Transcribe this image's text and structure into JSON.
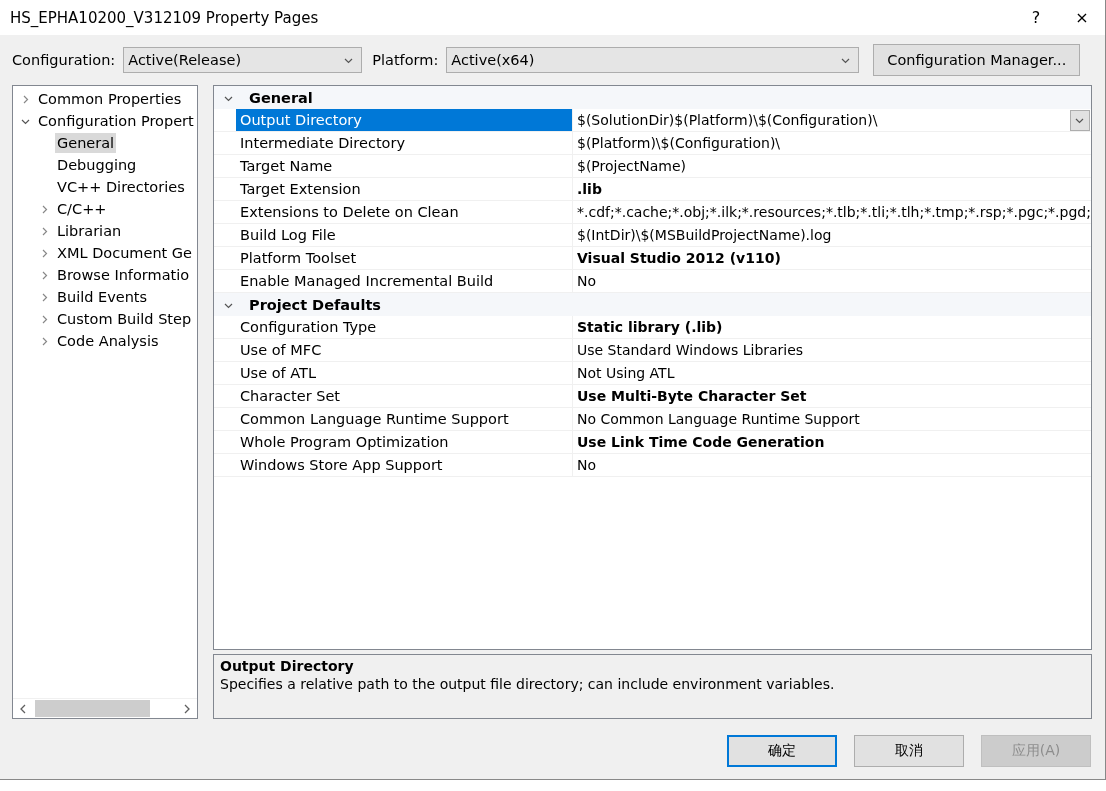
{
  "window": {
    "title": "HS_EPHA10200_V312109 Property Pages",
    "help": "?",
    "close": "×"
  },
  "toolbar": {
    "configuration_label": "Configuration:",
    "configuration": "Active(Release)",
    "platform_label": "Platform:",
    "platform": "Active(x64)",
    "manager_button": "Configuration Manager..."
  },
  "tree": [
    {
      "label": "Common Properties",
      "expanded": false,
      "selected": false
    },
    {
      "label": "Configuration Propert",
      "expanded": true,
      "selected": false,
      "children": [
        {
          "label": "General",
          "selected": true
        },
        {
          "label": "Debugging",
          "selected": false
        },
        {
          "label": "VC++ Directories",
          "selected": false
        },
        {
          "label": "C/C++",
          "expanded": false,
          "selected": false
        },
        {
          "label": "Librarian",
          "expanded": false,
          "selected": false
        },
        {
          "label": "XML Document Ge",
          "expanded": false,
          "selected": false
        },
        {
          "label": "Browse Informatio",
          "expanded": false,
          "selected": false
        },
        {
          "label": "Build Events",
          "expanded": false,
          "selected": false
        },
        {
          "label": "Custom Build Step",
          "expanded": false,
          "selected": false
        },
        {
          "label": "Code Analysis",
          "expanded": false,
          "selected": false
        }
      ]
    }
  ],
  "properties": [
    {
      "category": "General",
      "expanded": true,
      "rows": [
        {
          "name": "Output Directory",
          "value": "$(SolutionDir)$(Platform)\\$(Configuration)\\",
          "bold": false,
          "selected": true
        },
        {
          "name": "Intermediate Directory",
          "value": "$(Platform)\\$(Configuration)\\",
          "bold": false,
          "selected": false
        },
        {
          "name": "Target Name",
          "value": "$(ProjectName)",
          "bold": false,
          "selected": false
        },
        {
          "name": "Target Extension",
          "value": ".lib",
          "bold": true,
          "selected": false
        },
        {
          "name": "Extensions to Delete on Clean",
          "value": "*.cdf;*.cache;*.obj;*.ilk;*.resources;*.tlb;*.tli;*.tlh;*.tmp;*.rsp;*.pgc;*.pgd;",
          "bold": false,
          "selected": false
        },
        {
          "name": "Build Log File",
          "value": "$(IntDir)\\$(MSBuildProjectName).log",
          "bold": false,
          "selected": false
        },
        {
          "name": "Platform Toolset",
          "value": "Visual Studio 2012 (v110)",
          "bold": true,
          "selected": false
        },
        {
          "name": "Enable Managed Incremental Build",
          "value": "No",
          "bold": false,
          "selected": false
        }
      ]
    },
    {
      "category": "Project Defaults",
      "expanded": true,
      "rows": [
        {
          "name": "Configuration Type",
          "value": "Static library (.lib)",
          "bold": true,
          "selected": false
        },
        {
          "name": "Use of MFC",
          "value": "Use Standard Windows Libraries",
          "bold": false,
          "selected": false
        },
        {
          "name": "Use of ATL",
          "value": "Not Using ATL",
          "bold": false,
          "selected": false
        },
        {
          "name": "Character Set",
          "value": "Use Multi-Byte Character Set",
          "bold": true,
          "selected": false
        },
        {
          "name": "Common Language Runtime Support",
          "value": "No Common Language Runtime Support",
          "bold": false,
          "selected": false
        },
        {
          "name": "Whole Program Optimization",
          "value": "Use Link Time Code Generation",
          "bold": true,
          "selected": false
        },
        {
          "name": "Windows Store App Support",
          "value": "No",
          "bold": false,
          "selected": false
        }
      ]
    }
  ],
  "description": {
    "title": "Output Directory",
    "text": "Specifies a relative path to the output file directory; can include environment variables."
  },
  "buttons": [
    {
      "label": "确定",
      "default": true,
      "disabled": false
    },
    {
      "label": "取消",
      "default": false,
      "disabled": false
    },
    {
      "label": "应用(A)",
      "default": false,
      "disabled": true
    }
  ]
}
